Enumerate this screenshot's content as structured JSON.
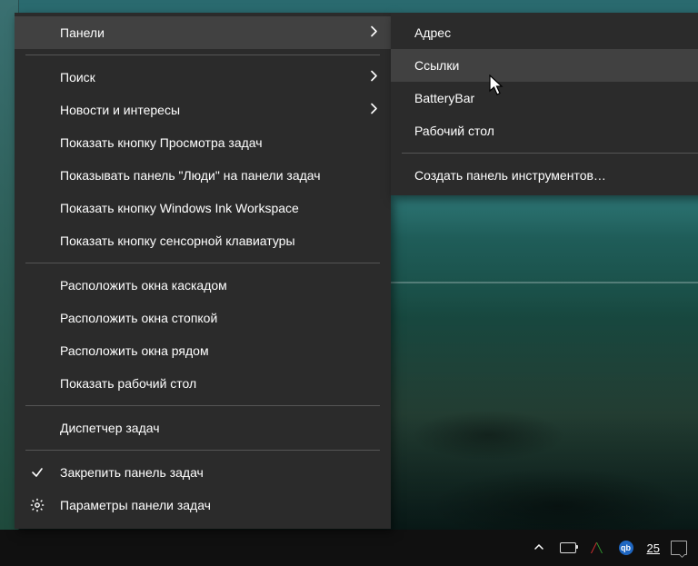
{
  "mainMenu": {
    "sections": [
      [
        {
          "id": "panels",
          "label": "Панели",
          "hasSubmenu": true,
          "highlighted": true
        }
      ],
      [
        {
          "id": "search",
          "label": "Поиск",
          "hasSubmenu": true
        },
        {
          "id": "news",
          "label": "Новости и интересы",
          "hasSubmenu": true
        },
        {
          "id": "taskview",
          "label": "Показать кнопку Просмотра задач"
        },
        {
          "id": "people",
          "label": "Показывать панель \"Люди\" на панели задач"
        },
        {
          "id": "ink",
          "label": "Показать кнопку Windows Ink Workspace"
        },
        {
          "id": "touchkb",
          "label": "Показать кнопку сенсорной клавиатуры"
        }
      ],
      [
        {
          "id": "cascade",
          "label": "Расположить окна каскадом"
        },
        {
          "id": "stack",
          "label": "Расположить окна стопкой"
        },
        {
          "id": "sidebyside",
          "label": "Расположить окна рядом"
        },
        {
          "id": "showdesktop",
          "label": "Показать рабочий стол"
        }
      ],
      [
        {
          "id": "taskmgr",
          "label": "Диспетчер задач"
        }
      ],
      [
        {
          "id": "lock",
          "label": "Закрепить панель задач",
          "leftIcon": "check"
        },
        {
          "id": "settings",
          "label": "Параметры панели задач",
          "leftIcon": "gear"
        }
      ]
    ]
  },
  "subMenu": {
    "sections": [
      [
        {
          "id": "address",
          "label": "Адрес"
        },
        {
          "id": "links",
          "label": "Ссылки",
          "highlighted": true
        },
        {
          "id": "batterybar",
          "label": "BatteryBar"
        },
        {
          "id": "desktop",
          "label": "Рабочий стол"
        }
      ],
      [
        {
          "id": "newtoolbar",
          "label": "Создать панель инструментов…"
        }
      ]
    ]
  },
  "taskbar": {
    "percent": "25"
  }
}
